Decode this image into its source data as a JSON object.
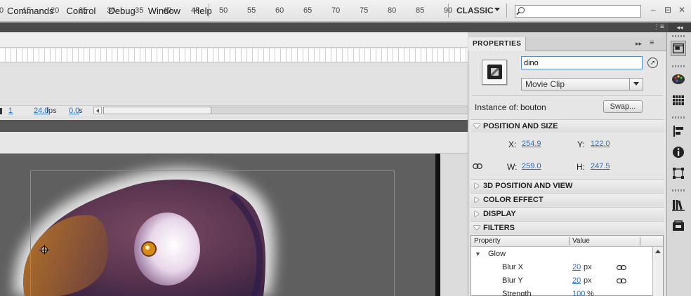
{
  "menubar": {
    "items": [
      "Commands",
      "Control",
      "Debug",
      "Window",
      "Help"
    ],
    "workspace": "CLASSIC",
    "search_value": "",
    "window_controls": [
      "–",
      "⊟",
      "✕"
    ]
  },
  "strip": {
    "menu_glyph": "⋮≡",
    "collapse_glyph": "◂◂"
  },
  "timeline": {
    "ruler_ticks": [
      "0",
      "15",
      "20",
      "25",
      "30",
      "35",
      "40",
      "45",
      "50",
      "55",
      "60",
      "65",
      "70",
      "75",
      "80",
      "85",
      "90"
    ],
    "current_frame": "1",
    "fps_value": "24.0",
    "fps_unit": "fps",
    "time_value": "0.0",
    "time_unit": "s"
  },
  "properties": {
    "tab_label": "PROPERTIES",
    "collapse_glyph": "▸▸",
    "menu_glyph": "≡",
    "instance_name": "dino",
    "symbol_type": "Movie Clip",
    "instance_of_label": "Instance of:",
    "instance_of_value": "bouton",
    "swap_label": "Swap...",
    "sections": {
      "position_size": "POSITION AND SIZE",
      "position_3d": "3D POSITION AND VIEW",
      "color_effect": "COLOR EFFECT",
      "display": "DISPLAY",
      "filters": "FILTERS"
    },
    "x_label": "X:",
    "x_value": "254.9",
    "y_label": "Y:",
    "y_value": "122.0",
    "w_label": "W:",
    "w_value": "259.0",
    "h_label": "H:",
    "h_value": "247.5"
  },
  "filters": {
    "col_property": "Property",
    "col_value": "Value",
    "rows": [
      {
        "property": "Glow",
        "value": "",
        "unit": "",
        "linked": false
      },
      {
        "property": "Blur X",
        "value": "20",
        "unit": "px",
        "linked": true
      },
      {
        "property": "Blur Y",
        "value": "20",
        "unit": "px",
        "linked": true
      },
      {
        "property": "Strength",
        "value": "100",
        "unit": "%",
        "linked": false
      }
    ]
  },
  "colors": {
    "accent_link": "#2a6fc0",
    "selection_outline": "#3aa0ff",
    "stage_bg": "#5f5f5f"
  },
  "dock_icons": [
    "properties-panel-icon",
    "color-palette-icon",
    "swatches-grid-icon",
    "align-icon",
    "info-icon",
    "transform-icon",
    "library-icon",
    "components-icon"
  ]
}
